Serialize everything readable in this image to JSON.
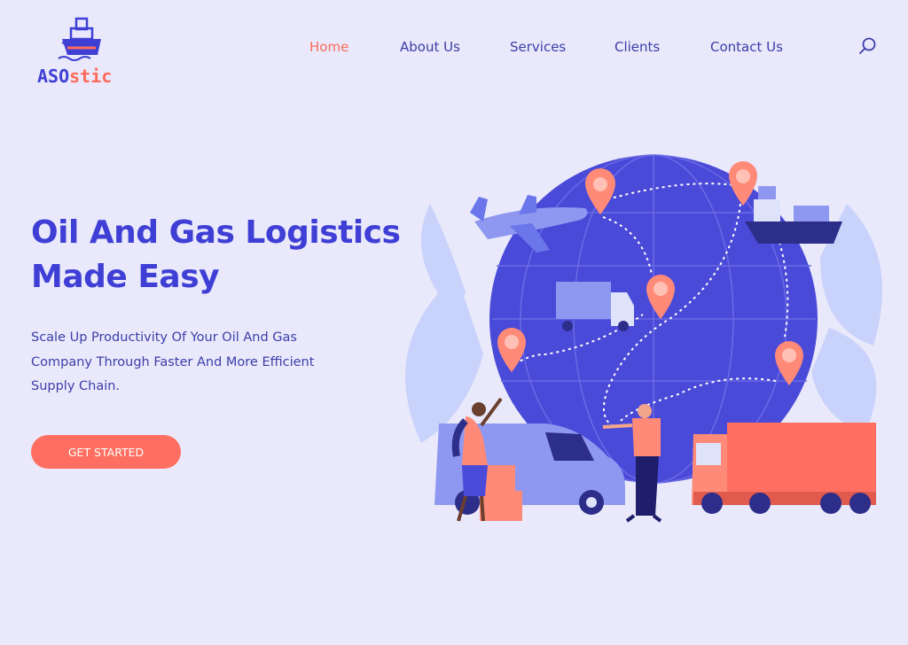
{
  "brand": {
    "name_part1": "ASO",
    "name_part2": "stic"
  },
  "nav": {
    "items": [
      {
        "label": "Home",
        "active": true
      },
      {
        "label": "About Us",
        "active": false
      },
      {
        "label": "Services",
        "active": false
      },
      {
        "label": "Clients",
        "active": false
      },
      {
        "label": "Contact Us",
        "active": false
      }
    ]
  },
  "hero": {
    "title_line1": "Oil And Gas Logistics",
    "title_line2": "Made Easy",
    "subtitle_line1": "Scale Up Productivity Of Your Oil And Gas",
    "subtitle_line2": "Company Through Faster And More Efficient",
    "subtitle_line3": "Supply Chain.",
    "cta_label": "GET STARTED"
  },
  "icons": {
    "search": "search-icon"
  },
  "colors": {
    "accent": "#ff6f61",
    "primary": "#3f3fd6",
    "background": "#e9e9fb"
  }
}
